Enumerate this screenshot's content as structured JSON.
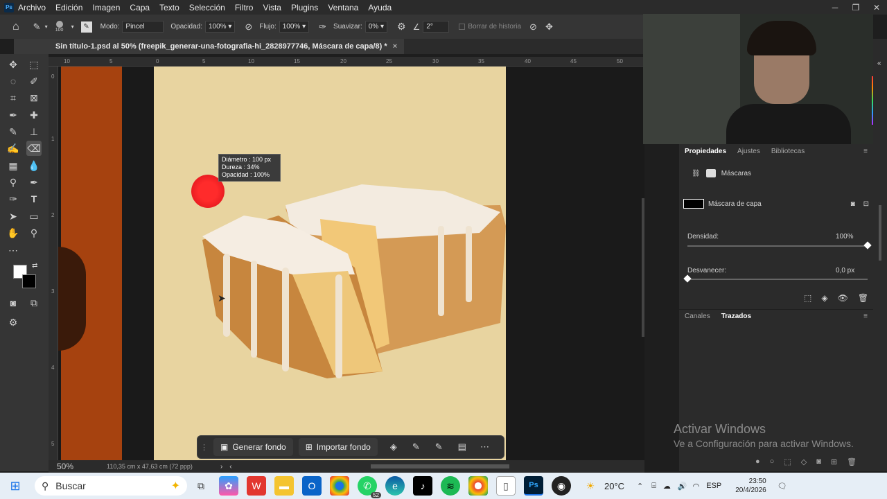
{
  "menu": [
    "Archivo",
    "Edición",
    "Imagen",
    "Capa",
    "Texto",
    "Selección",
    "Filtro",
    "Vista",
    "Plugins",
    "Ventana",
    "Ayuda"
  ],
  "app_logo": "Ps",
  "options": {
    "brush_size": "100",
    "modo_label": "Modo:",
    "modo_value": "Pincel",
    "opacidad_label": "Opacidad:",
    "opacidad_value": "100%",
    "flujo_label": "Flujo:",
    "flujo_value": "100%",
    "suavizar_label": "Suavizar:",
    "suavizar_value": "0%",
    "angle_value": "2°",
    "borrar_historia": "Borrar de historia"
  },
  "document_tab": "Sin título-1.psd al 50% (freepik_generar-una-fotografia-hi_2828977746, Máscara de capa/8) *",
  "ruler_top_labels": [
    "10",
    "5",
    "0",
    "5",
    "10",
    "15",
    "20",
    "25",
    "30",
    "35",
    "40",
    "45",
    "50"
  ],
  "ruler_left_labels": [
    "0",
    "1",
    "2",
    "3",
    "4",
    "5"
  ],
  "brush_tooltip": {
    "diametro": "Diámetro : 100 px",
    "dureza": "Dureza : 34%",
    "opacidad": "Opacidad : 100%"
  },
  "floating_bar": {
    "generar_fondo": "Generar fondo",
    "importar_fondo": "Importar fondo"
  },
  "status": {
    "zoom": "50%",
    "doc_size": "110,35 cm x 47,63 cm (72 ppp)"
  },
  "properties": {
    "tabs": [
      "Propiedades",
      "Ajustes",
      "Bibliotecas"
    ],
    "section_title": "Máscaras",
    "layer_mask_label": "Máscara de capa",
    "densidad_label": "Densidad:",
    "densidad_value": "100%",
    "densidad_fraction": 1.0,
    "desvanecer_label": "Desvanecer:",
    "desvanecer_value": "0,0 px",
    "desvanecer_fraction": 0.0,
    "lower_tabs": [
      "Canales",
      "Trazados"
    ]
  },
  "watermark": {
    "line1": "Activar Windows",
    "line2": "Ve a Configuración para activar Windows."
  },
  "taskbar": {
    "search_placeholder": "Buscar",
    "whatsapp_badge": "52",
    "weather": "20°C",
    "language": "ESP",
    "time": "23:50",
    "date": "20/4/2026"
  },
  "colors": {
    "canvas_bg": "#e8d4a0",
    "left_strip": "#a6420f",
    "brush_cursor": "#e8141e",
    "ps_blue": "#4fb1ff"
  }
}
